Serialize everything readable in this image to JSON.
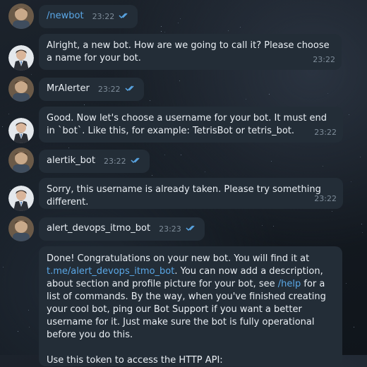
{
  "messages": [
    {
      "sender": "user",
      "text": "/newbot",
      "time": "23:22",
      "read_ticks": "double-check-icon"
    },
    {
      "sender": "bot",
      "text": "Alright, a new bot. How are we going to call it? Please choose a name for your bot.",
      "time": "23:22"
    },
    {
      "sender": "user",
      "text": "MrAlerter",
      "time": "23:22",
      "read_ticks": "double-check-icon"
    },
    {
      "sender": "bot",
      "text": "Good. Now let's choose a username for your bot. It must end in `bot`. Like this, for example: TetrisBot or tetris_bot.",
      "time": "23:22"
    },
    {
      "sender": "user",
      "text": "alertik_bot",
      "time": "23:22",
      "read_ticks": "double-check-icon"
    },
    {
      "sender": "bot",
      "text": "Sorry, this username is already taken. Please try something different.",
      "time": "23:22"
    },
    {
      "sender": "user",
      "text": "alert_devops_itmo_bot",
      "time": "23:23",
      "read_ticks": "double-check-icon"
    },
    {
      "sender": "bot",
      "parts": {
        "p1": "Done! Congratulations on your new bot. You will find it at ",
        "link": "t.me/alert_devops_itmo_bot",
        "p2": ". You can now add a description, about section and profile picture for your bot, see ",
        "cmd": "/help",
        "p3": " for a list of commands. By the way, when you've finished creating your cool bot, ping our Bot Support if you want a better username for it. Just make sure the bot is fully operational before you do this.",
        "p4": "Use this token to access the HTTP API:"
      }
    }
  ],
  "colors": {
    "bubble": "#232d37",
    "text": "#e9eef3",
    "meta": "#7e8c99",
    "link": "#5aa7e6"
  }
}
